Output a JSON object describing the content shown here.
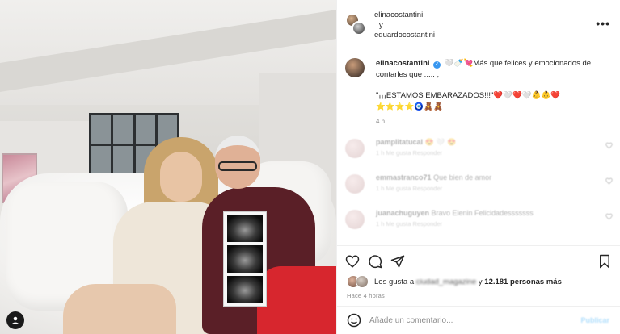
{
  "header": {
    "user1": "elinacostantini",
    "conjunction": "y",
    "user2": "eduardocostantini",
    "more_label": "•••"
  },
  "caption": {
    "username": "elinacostantini",
    "text1": "🤍🍼💘Más que felices y emocionados de contarles que ..... ;",
    "text2": "\"¡¡¡ESTAMOS EMBARAZADOS!!!\"❤️🤍❤️🤍👶👶❤️",
    "text3": "⭐⭐⭐⭐🧿🧸🧸",
    "time": "4 h"
  },
  "comments": [
    {
      "user": "pamplitatucal",
      "text": "😍 🤍 😍",
      "meta": "1 h Me gusta Responder"
    },
    {
      "user": "emmastranco71",
      "text": "Que bien de amor",
      "meta": "1 h Me gusta Responder"
    },
    {
      "user": "juanachuguyen",
      "text": "Bravo Elenin Felicidadesssssss",
      "meta": "1 h Me gusta Responder"
    }
  ],
  "likes": {
    "prefix": "Les gusta a",
    "blurred_user": "ciudad_magazine",
    "suffix": "y",
    "count": "12.181 personas más"
  },
  "ago": "Hace 4 horas",
  "add_comment": {
    "placeholder": "Añade un comentario...",
    "publish": "Publicar"
  },
  "colors": {
    "text": "#262626",
    "muted": "#8e8e8e",
    "verified": "#3897f0",
    "border": "#efefef"
  }
}
